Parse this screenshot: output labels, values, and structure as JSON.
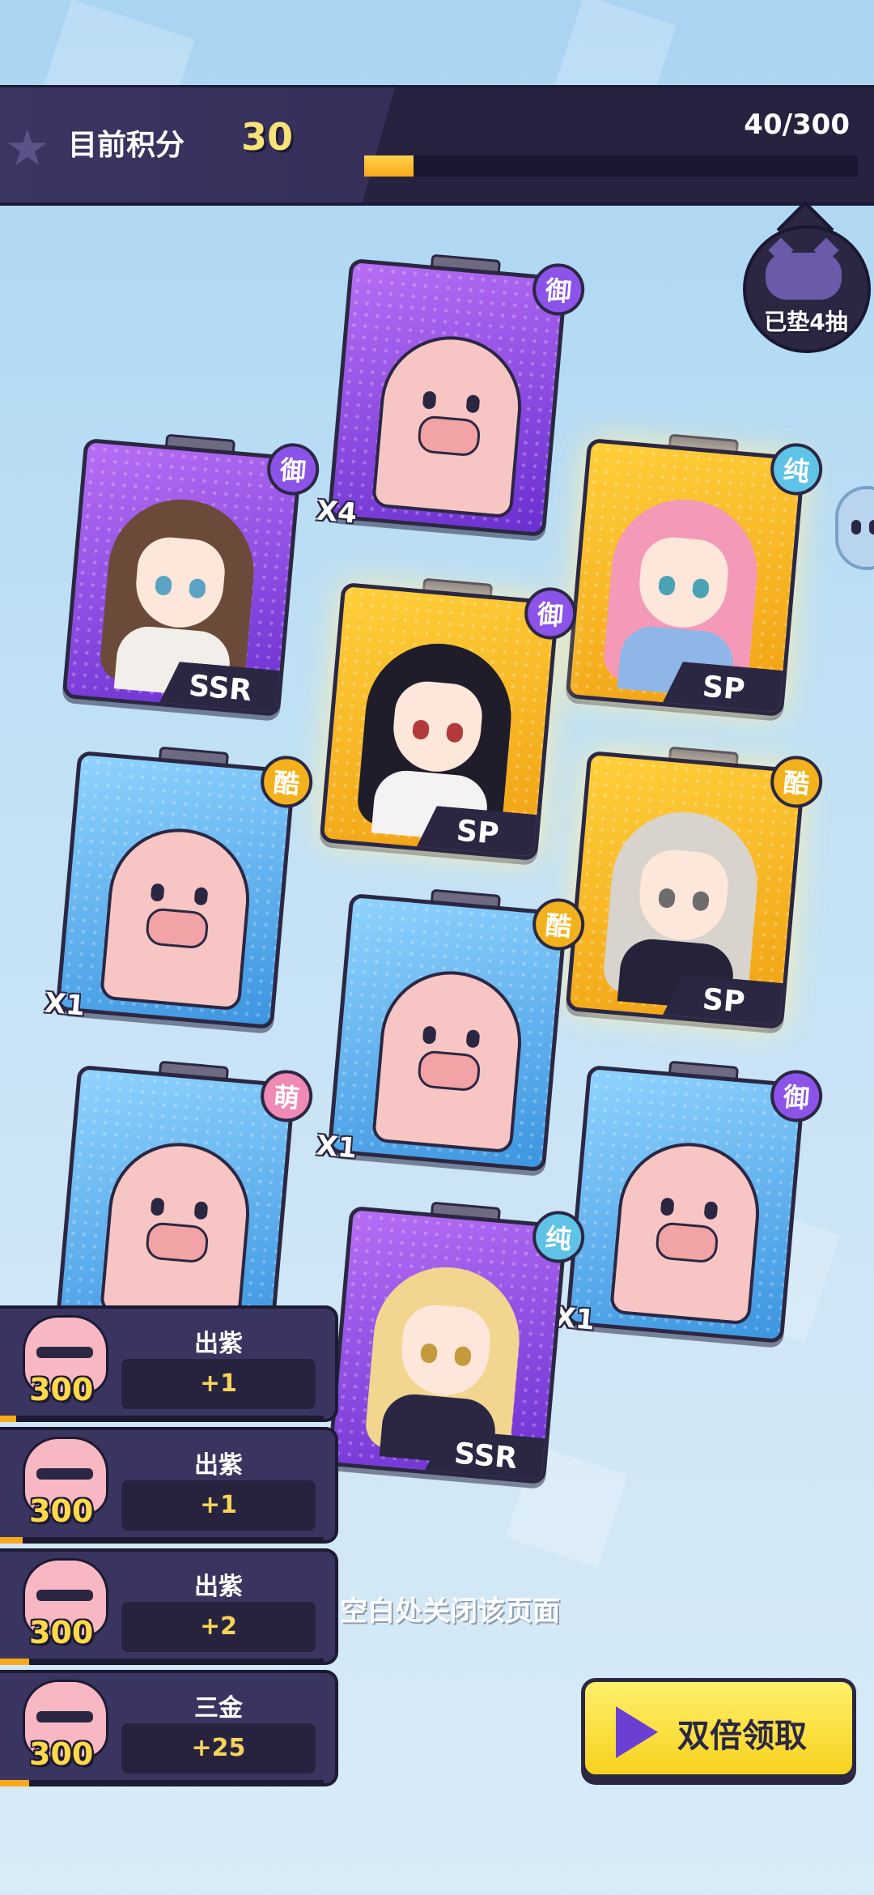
{
  "header": {
    "score_label": "目前积分",
    "score_value": "30",
    "progress_text": "40/300",
    "progress_fraction": 0.1
  },
  "pity": {
    "label": "已垫4抽"
  },
  "cards": [
    {
      "id": "c1",
      "type": "pig",
      "color": "purple",
      "badge": "御",
      "grade": "",
      "count": "X4"
    },
    {
      "id": "c2",
      "type": "girl",
      "color": "purple",
      "badge": "御",
      "grade": "SSR",
      "count": ""
    },
    {
      "id": "c3",
      "type": "girl",
      "color": "gold",
      "badge": "纯",
      "grade": "SP",
      "count": ""
    },
    {
      "id": "c4",
      "type": "girl",
      "color": "gold",
      "badge": "御",
      "grade": "SP",
      "count": ""
    },
    {
      "id": "c5",
      "type": "pig",
      "color": "blue",
      "badge": "酷",
      "grade": "",
      "count": "X1"
    },
    {
      "id": "c6",
      "type": "girl",
      "color": "gold",
      "badge": "酷",
      "grade": "SP",
      "count": ""
    },
    {
      "id": "c7",
      "type": "pig",
      "color": "blue",
      "badge": "酷",
      "grade": "",
      "count": "X1"
    },
    {
      "id": "c8",
      "type": "pig",
      "color": "blue",
      "badge": "萌",
      "grade": "",
      "count": ""
    },
    {
      "id": "c9",
      "type": "pig",
      "color": "blue",
      "badge": "御",
      "grade": "",
      "count": "X1"
    },
    {
      "id": "c10",
      "type": "girl",
      "color": "purple",
      "badge": "纯",
      "grade": "SSR",
      "count": ""
    }
  ],
  "rewards": [
    {
      "badge_value": "300",
      "title": "出紫",
      "value": "+1",
      "fill": 0.05
    },
    {
      "badge_value": "300",
      "title": "出紫",
      "value": "+1",
      "fill": 0.07
    },
    {
      "badge_value": "300",
      "title": "出紫",
      "value": "+2",
      "fill": 0.09
    },
    {
      "badge_value": "300",
      "title": "三金",
      "value": "+25",
      "fill": 0.09
    }
  ],
  "close_hint": "空白处关闭该页面",
  "double_button": "双倍领取",
  "colors": {
    "accent_yellow": "#f6d21e",
    "panel_dark": "#2b2743",
    "purple": "#8b53e8"
  }
}
